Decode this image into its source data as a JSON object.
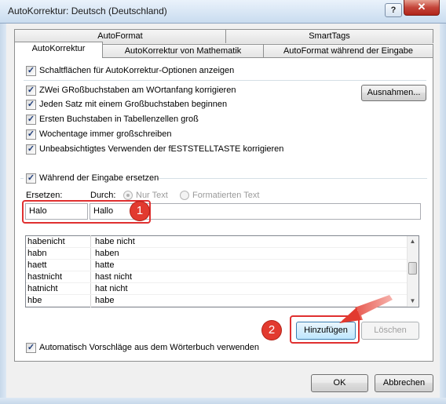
{
  "window": {
    "title": "AutoKorrektur: Deutsch (Deutschland)",
    "help_label": "?",
    "close_label": "✕"
  },
  "tabs": {
    "back": [
      "AutoFormat",
      "SmartTags"
    ],
    "front": [
      "AutoKorrektur",
      "AutoKorrektur von Mathematik",
      "AutoFormat während der Eingabe"
    ],
    "active": "AutoKorrektur"
  },
  "options": {
    "show_buttons": "Schaltflächen für AutoKorrektur-Optionen anzeigen",
    "two_caps": "ZWei GRoßbuchstaben am WOrtanfang korrigieren",
    "sentence_caps": "Jeden Satz mit einem Großbuchstaben beginnen",
    "table_caps": "Ersten Buchstaben in Tabellenzellen groß",
    "weekdays": "Wochentage immer großschreiben",
    "capslock": "Unbeabsichtigtes Verwenden der fESTSTELLTASTE korrigieren",
    "exceptions_button": "Ausnahmen..."
  },
  "replace": {
    "toggle_label": "Während der Eingabe ersetzen",
    "replace_label": "Ersetzen:",
    "with_label": "Durch:",
    "radio_plain": "Nur Text",
    "radio_formatted": "Formatierten Text",
    "replace_value": "Halo",
    "with_value": "Hallo",
    "rows": [
      [
        "habenicht",
        "habe nicht"
      ],
      [
        "habn",
        "haben"
      ],
      [
        "haett",
        "hatte"
      ],
      [
        "hastnicht",
        "hast nicht"
      ],
      [
        "hatnicht",
        "hat nicht"
      ],
      [
        "hbe",
        "habe"
      ]
    ],
    "add_button": "Hinzufügen",
    "delete_button": "Löschen",
    "dictionary_label": "Automatisch Vorschläge aus dem Wörterbuch verwenden"
  },
  "footer": {
    "ok": "OK",
    "cancel": "Abbrechen"
  },
  "annotations": {
    "step1": "1",
    "step2": "2"
  },
  "colors": {
    "callout": "#e03030",
    "badge": "#e23a2f",
    "titlebar": "#c9dcef"
  }
}
